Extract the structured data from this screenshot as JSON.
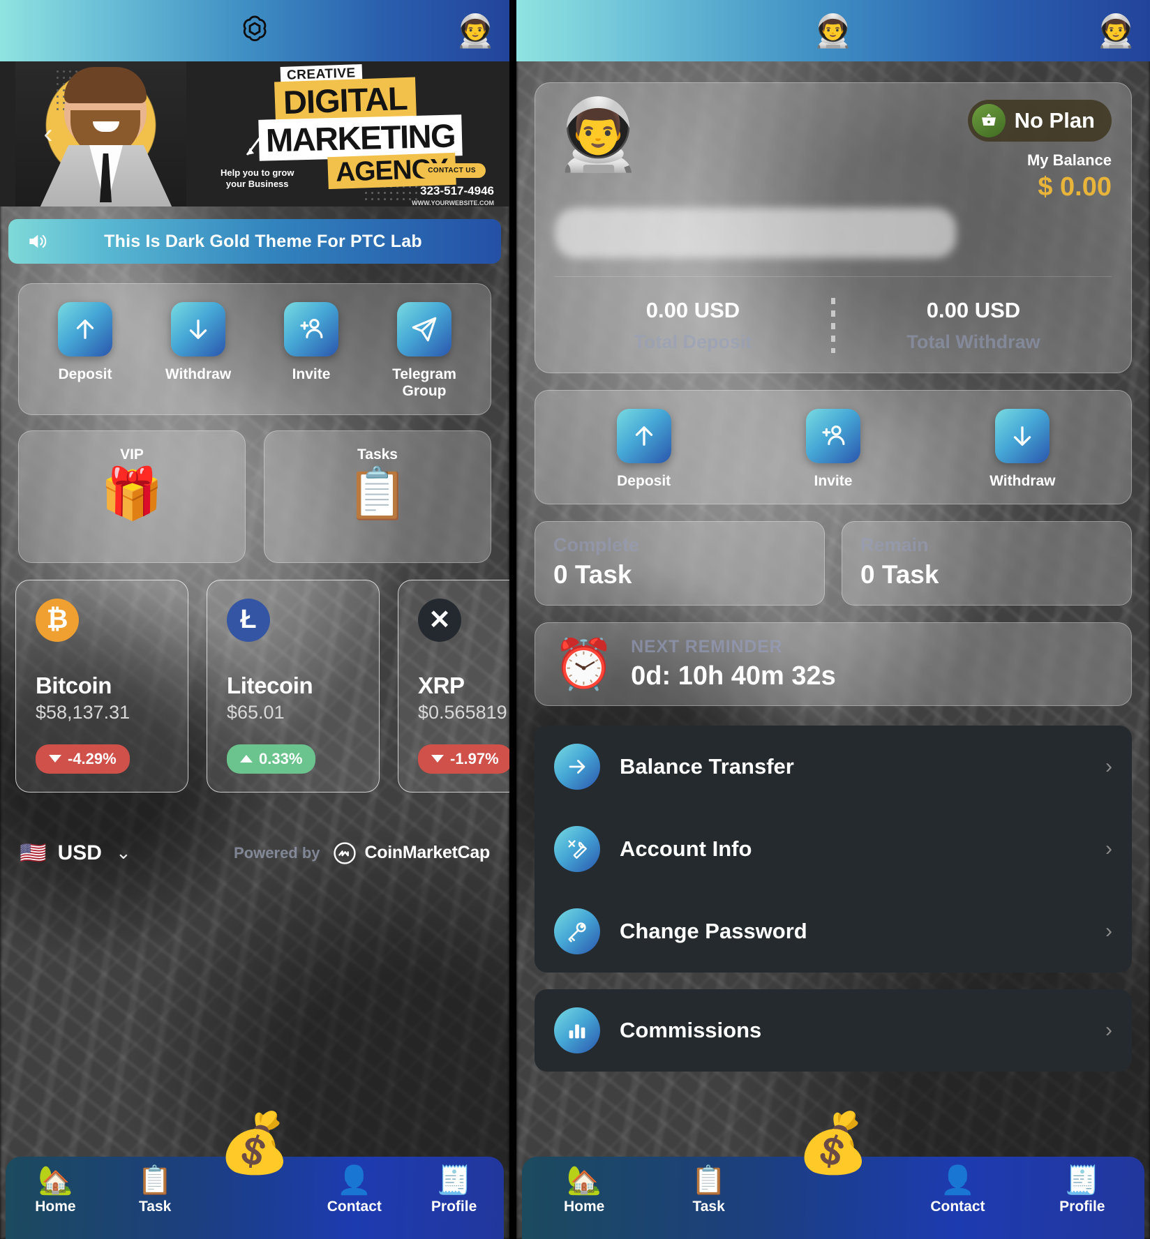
{
  "left": {
    "topbar": {
      "logo_icon": "openai-logo-icon",
      "avatar_icon": "user-avatar-emoji"
    },
    "banner": {
      "creative": "CREATIVE",
      "digital": "DIGITAL",
      "marketing": "MARKETING",
      "agency": "AGENCY",
      "tagline": "Help you to grow\nyour Business",
      "contact_label": "CONTACT US",
      "phone": "323-517-4946",
      "website": "WWW.YOURWEBSITE.COM",
      "prev_icon": "chevron-left-icon",
      "next_icon": "chevron-right-icon"
    },
    "marquee": {
      "icon": "speaker-icon",
      "text": "This Is Dark Gold Theme For PTC Lab"
    },
    "quick_actions": [
      {
        "label": "Deposit",
        "icon": "arrow-up-icon"
      },
      {
        "label": "Withdraw",
        "icon": "arrow-down-icon"
      },
      {
        "label": "Invite",
        "icon": "add-user-icon"
      },
      {
        "label": "Telegram Group",
        "icon": "paper-plane-icon"
      }
    ],
    "feature_cards": [
      {
        "title": "VIP",
        "emoji": "🎁"
      },
      {
        "title": "Tasks",
        "emoji": "📋"
      }
    ],
    "crypto": [
      {
        "name": "Bitcoin",
        "symbol": "₿",
        "price": "$58,137.31",
        "change": "-4.29%",
        "direction": "down"
      },
      {
        "name": "Litecoin",
        "symbol": "Ł",
        "price": "$65.01",
        "change": "0.33%",
        "direction": "up"
      },
      {
        "name": "XRP",
        "symbol": "✕",
        "price": "$0.565819",
        "change": "-1.97%",
        "direction": "down"
      }
    ],
    "currency": {
      "flag": "🇺🇸",
      "code": "USD",
      "chevron_icon": "chevron-down-icon"
    },
    "attribution": {
      "powered_by": "Powered by",
      "provider": "CoinMarketCap",
      "logo_icon": "coinmarketcap-logo-icon"
    }
  },
  "right": {
    "topbar": {
      "left_avatar_icon": "user-avatar-emoji",
      "right_avatar_icon": "user-avatar-emoji"
    },
    "profile": {
      "avatar_emoji": "👨‍🚀",
      "plan_badge": "No Plan",
      "plan_icon": "basket-icon",
      "balance_label": "My Balance",
      "balance_amount": "$ 0.00"
    },
    "stats": [
      {
        "value": "0.00 USD",
        "label": "Total Deposit"
      },
      {
        "value": "0.00 USD",
        "label": "Total Withdraw"
      }
    ],
    "quick_actions": [
      {
        "label": "Deposit",
        "icon": "arrow-up-icon"
      },
      {
        "label": "Invite",
        "icon": "add-user-icon"
      },
      {
        "label": "Withdraw",
        "icon": "arrow-down-icon"
      }
    ],
    "task_cards": [
      {
        "label": "Complete",
        "value": "0 Task"
      },
      {
        "label": "Remain",
        "value": "0 Task"
      }
    ],
    "reminder": {
      "emoji": "⏰",
      "label": "NEXT REMINDER",
      "value": "0d: 10h 40m 32s"
    },
    "menu": [
      {
        "label": "Balance Transfer",
        "icon": "arrow-right-icon"
      },
      {
        "label": "Account Info",
        "icon": "tools-icon"
      },
      {
        "label": "Change Password",
        "icon": "key-icon"
      }
    ],
    "menu2": [
      {
        "label": "Commissions",
        "icon": "bar-chart-icon"
      }
    ]
  },
  "bottom_nav": [
    {
      "label": "Home",
      "emoji": "🏡"
    },
    {
      "label": "Task",
      "emoji": "📋"
    },
    {
      "label": "",
      "emoji": "💰"
    },
    {
      "label": "Contact",
      "emoji": "👤"
    },
    {
      "label": "Profile",
      "emoji": "🧾"
    }
  ]
}
